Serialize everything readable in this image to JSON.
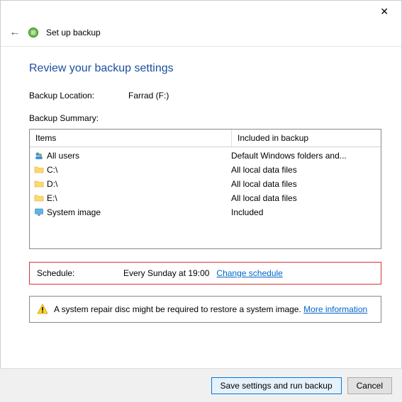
{
  "window": {
    "title": "Set up backup"
  },
  "page": {
    "heading": "Review your backup settings",
    "backup_location_label": "Backup Location:",
    "backup_location_value": "Farrad (F:)",
    "backup_summary_label": "Backup Summary:"
  },
  "table": {
    "col_items": "Items",
    "col_included": "Included in backup",
    "rows": [
      {
        "icon": "users",
        "label": "All users",
        "included": "Default Windows folders and..."
      },
      {
        "icon": "folder",
        "label": "C:\\",
        "included": "All local data files"
      },
      {
        "icon": "folder",
        "label": "D:\\",
        "included": "All local data files"
      },
      {
        "icon": "folder",
        "label": "E:\\",
        "included": "All local data files"
      },
      {
        "icon": "monitor",
        "label": "System image",
        "included": "Included"
      }
    ]
  },
  "schedule": {
    "label": "Schedule:",
    "value": "Every Sunday at 19:00",
    "change_link": "Change schedule"
  },
  "warning": {
    "text": "A system repair disc might be required to restore a system image. ",
    "link": "More information"
  },
  "footer": {
    "save": "Save settings and run backup",
    "cancel": "Cancel"
  }
}
